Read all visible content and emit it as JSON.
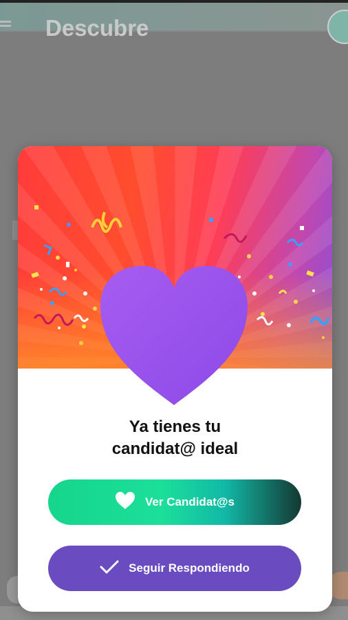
{
  "app": {
    "title": "Descubre"
  },
  "modal": {
    "title_line1": "Ya tienes tu",
    "title_line2": "candidat@ ideal",
    "primary_button": {
      "label": "Ver Candidat@s",
      "icon": "heart-icon"
    },
    "secondary_button": {
      "label": "Seguir Respondiendo",
      "icon": "check-icon"
    }
  },
  "colors": {
    "heart": "#9b55f0",
    "primary_start": "#16d58c",
    "primary_end": "#143833",
    "secondary": "#6a4cc0"
  }
}
